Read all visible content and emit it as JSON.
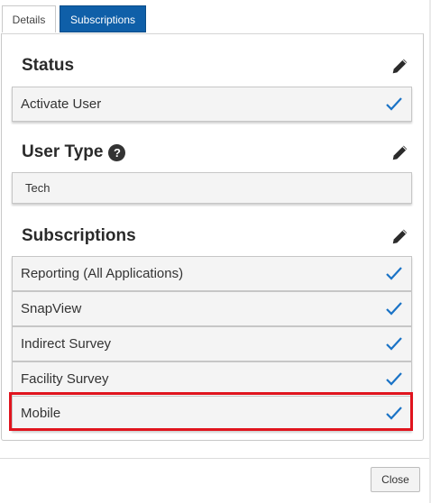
{
  "tabs": {
    "details": "Details",
    "subscriptions": "Subscriptions"
  },
  "status": {
    "title": "Status",
    "value": "Activate User"
  },
  "user_type": {
    "title": "User Type",
    "value": "Tech",
    "help_glyph": "?"
  },
  "subscriptions": {
    "title": "Subscriptions",
    "items": [
      {
        "label": "Reporting (All Applications)"
      },
      {
        "label": "SnapView"
      },
      {
        "label": "Indirect Survey"
      },
      {
        "label": "Facility Survey"
      },
      {
        "label": "Mobile"
      }
    ]
  },
  "footer": {
    "close_label": "Close"
  },
  "colors": {
    "accent": "#0f5fa8",
    "check": "#1a73c6",
    "highlight": "#e0141e"
  },
  "icons": {
    "edit": "pencil-icon",
    "check": "checkmark-icon",
    "help": "question-icon"
  }
}
